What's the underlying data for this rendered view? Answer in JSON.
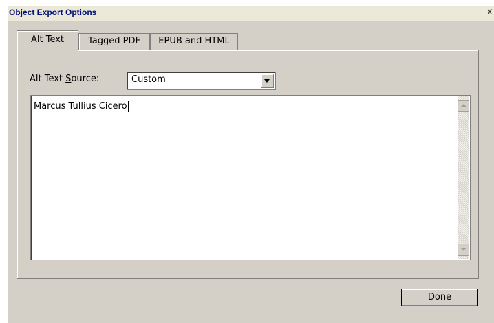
{
  "window": {
    "title": "Object Export Options",
    "close_glyph": "x"
  },
  "tabs": [
    {
      "label": "Alt Text",
      "active": true
    },
    {
      "label": "Tagged PDF",
      "active": false
    },
    {
      "label": "EPUB and HTML",
      "active": false
    }
  ],
  "alt_text": {
    "source_label_pre": "Alt Text ",
    "source_label_accel": "S",
    "source_label_post": "ource:",
    "source_value": "Custom",
    "text_value": "Marcus Tullius Cicero"
  },
  "buttons": {
    "done": "Done"
  },
  "icons": {
    "close": "close-icon",
    "dropdown": "chevron-down-icon",
    "scroll_up": "scroll-up-arrow-icon",
    "scroll_down": "scroll-down-arrow-icon"
  }
}
